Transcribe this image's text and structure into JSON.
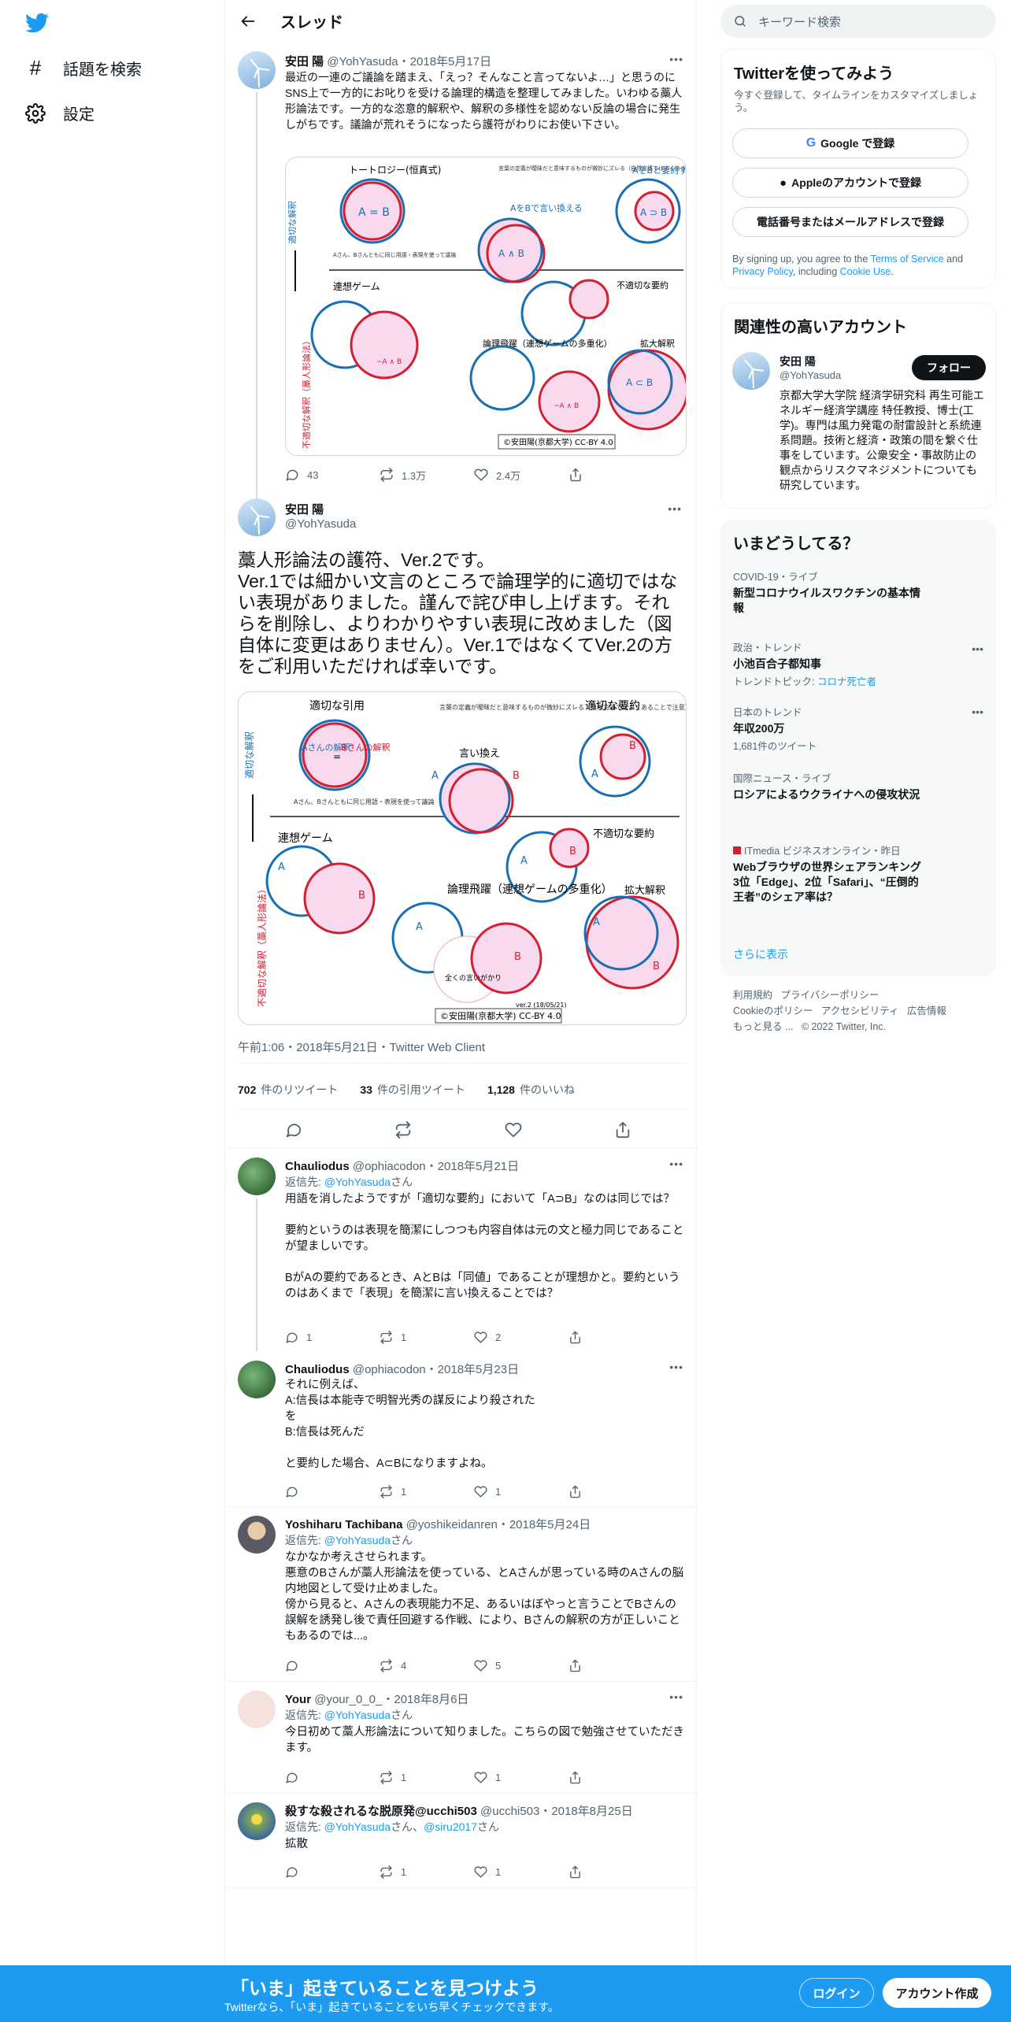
{
  "nav": {
    "explore_label": "話題を検索",
    "settings_label": "設定"
  },
  "header": {
    "title": "スレッド"
  },
  "tweet1": {
    "name": "安田 陽",
    "handle": "@YohYasuda",
    "date": "2018年5月17日",
    "text": "最近の一連のご議論を踏まえ、「えっ？そんなこと言ってないよ…」と思うのにSNS上で一方的にお叱りを受ける論理的構造を整理してみました。いわゆる藁人形論法です。一方的な恣意的解釈や、解釈の多様性を認めない反論の場合に発生しがちです。議論が荒れそうになったら護符がわりにお使い下さい。",
    "replies": "43",
    "retweets": "1.3万",
    "likes": "2.4万"
  },
  "diagram1": {
    "tautology": "トートロジー(恒真式)",
    "eq": "A = B",
    "appropriate_summary": "AをBと要約する",
    "rephrase": "AをBで言い換える",
    "left_top": "適切な解釈",
    "left_bottom": "不適切な解釈（藁人形論法）",
    "assoc": "連想ゲーム",
    "inappropriate": "不適切な要約",
    "leap": "論理飛躍（連想ゲームの多重化）",
    "expand": "拡大解釈",
    "credit": "©安田陽(京都大学) CC-BY 4.0",
    "a_and_b": "A ∧ B",
    "a_sup_b": "A ⊃ B",
    "a_sub_b": "A ⊂ B",
    "not_a_and_b": "~A ∧ B",
    "note_same": "Aさん、Bさんともに同じ用語・表現を使って議論",
    "note_def": "言葉の定義が曖昧だと意味するものが微妙にズレる（自然言語ではよくあることで注意）"
  },
  "tweet2": {
    "name": "安田 陽",
    "handle": "@YohYasuda",
    "text": "藁人形論法の護符、Ver.2です。\nVer.1では細かい文言のところで論理学的に適切ではない表現がありました。謹んで詫び申し上げます。それらを削除し、よりわかりやすい表現に改めました（図自体に変更はありません）。Ver.1ではなくてVer.2の方をご利用いただければ幸いです。",
    "time": "午前1:06・2018年5月21日・Twitter Web Client",
    "retweets_n": "702",
    "retweets_label": "件のリツイート",
    "quotes_n": "33",
    "quotes_label": "件の引用ツイート",
    "likes_n": "1,128",
    "likes_label": "件のいいね"
  },
  "diagram2": {
    "proper_quote": "適切な引用",
    "proper_summary": "適切な要約",
    "a_interp": "Aさんの解釈",
    "b_interp": "Bさんの解釈",
    "eq": "=",
    "rephrase": "言い換え",
    "left_top": "適切な解釈",
    "left_bottom": "不適切な解釈（藁人形論法）",
    "assoc": "連想ゲーム",
    "inappropriate": "不適切な要約",
    "leap": "論理飛躍（連想ゲームの多重化）",
    "expand": "拡大解釈",
    "credit": "©安田陽(京都大学) CC-BY 4.0",
    "ver": "ver.2 (18/05/21)",
    "A": "A",
    "B": "B",
    "no_relation": "全くの言いがかり",
    "note_same": "Aさん、Bさんともに同じ用語・表現を使って議論",
    "note_def": "言葉の定義が曖昧だと意味するものが微妙にズレる（自然言語ではよくあることで注意）"
  },
  "replies": [
    {
      "name": "Chauliodus",
      "handle": "@ophiacodon",
      "date": "2018年5月21日",
      "reply_to_label": "返信先:",
      "reply_to": "@YohYasuda",
      "reply_to_suffix": "さん",
      "text": "用語を消したようですが「適切な要約」において「A⊃B」なのは同じでは？\n\n要約というのは表現を簡潔にしつつも内容自体は元の文と極力同じであることが望ましいです。\n\nBがAの要約であるとき、AとBは「同値」であることが理想かと。要約というのはあくまで「表現」を簡潔に言い換えることでは？",
      "reply_count": "1",
      "retweets": "1",
      "likes": "2"
    },
    {
      "name": "Chauliodus",
      "handle": "@ophiacodon",
      "date": "2018年5月23日",
      "text": "それに例えば、\nA:信長は本能寺で明智光秀の謀反により殺された\nを\nB:信長は死んだ\n\nと要約した場合、A⊂Bになりますよね。",
      "reply_count": "",
      "retweets": "1",
      "likes": "1"
    },
    {
      "name": "Yoshiharu Tachibana",
      "handle": "@yoshikeidanren",
      "date": "2018年5月24日",
      "reply_to_label": "返信先:",
      "reply_to": "@YohYasuda",
      "reply_to_suffix": "さん",
      "text": "なかなか考えさせられます。\n悪意のBさんが藁人形論法を使っている、とAさんが思っている時のAさんの脳内地図として受け止めました。\n傍から見ると、Aさんの表現能力不足、あるいはぼやっと言うことでBさんの誤解を誘発し後で責任回避する作戦、により、Bさんの解釈の方が正しいこともあるのでは...。",
      "reply_count": "",
      "retweets": "4",
      "likes": "5"
    },
    {
      "name": "Your",
      "handle": "@your_0_0_",
      "date": "2018年8月6日",
      "reply_to_label": "返信先:",
      "reply_to": "@YohYasuda",
      "reply_to_suffix": "さん",
      "text": "今日初めて藁人形論法について知りました。こちらの図で勉強させていただきます。",
      "reply_count": "",
      "retweets": "1",
      "likes": "1"
    },
    {
      "name": "殺すな殺されるな脱原発@ucchi503",
      "handle": "@ucchi503",
      "date": "2018年8月25日",
      "reply_to_label": "返信先:",
      "reply_to": "@YohYasuda",
      "reply_to_mid": "さん、",
      "reply_to2": "@siru2017",
      "reply_to_suffix": "さん",
      "text": "拡散",
      "reply_count": "",
      "retweets": "1",
      "likes": "1"
    }
  ],
  "right": {
    "search_placeholder": "キーワード検索",
    "signup_title": "Twitterを使ってみよう",
    "signup_sub": "今すぐ登録して、タイムラインをカスタマイズしましょう。",
    "google_btn": "Google で登録",
    "apple_btn": "Appleのアカウントで登録",
    "phone_btn": "電話番号またはメールアドレスで登録",
    "terms_pre": "By signing up, you agree to the ",
    "terms_tos": "Terms of Service",
    "terms_and": " and ",
    "terms_privacy": "Privacy Policy",
    "terms_incl": ", including ",
    "terms_cookie": "Cookie Use",
    "terms_end": ".",
    "related_title": "関連性の高いアカウント",
    "related_name": "安田 陽",
    "related_handle": "@YohYasuda",
    "follow_btn": "フォロー",
    "related_bio": "京都大学大学院 経済学研究科 再生可能エネルギー経済学講座 特任教授、博士(工学)。専門は風力発電の耐雷設計と系統連系問題。技術と経済・政策の間を繋ぐ仕事をしています。公衆安全・事故防止の観点からリスクマネジメントについても研究しています。",
    "trends_title": "いまどうしてる？",
    "trends": [
      {
        "cat": "COVID-19・ライブ",
        "title": "新型コロナウイルスワクチンの基本情報",
        "sub": ""
      },
      {
        "cat": "政治・トレンド",
        "title": "小池百合子都知事",
        "sub_pre": "トレンドトピック: ",
        "sub_link": "コロナ死亡者"
      },
      {
        "cat": "日本のトレンド",
        "title": "年収200万",
        "sub": "1,681件のツイート"
      },
      {
        "cat": "国際ニュース・ライブ",
        "title": "ロシアによるウクライナへの侵攻状況",
        "sub": ""
      },
      {
        "cat": "ITmedia ビジネスオンライン・昨日",
        "title": "Webブラウザの世界シェアランキング　3位「Edge」、2位「Safari」、“圧倒的王者”のシェア率は？",
        "sub": ""
      }
    ],
    "show_more": "さらに表示",
    "footer": [
      "利用規約",
      "プライバシーポリシー",
      "Cookieのポリシー",
      "アクセシビリティ",
      "広告情報",
      "もっと見る ...",
      "© 2022 Twitter, Inc."
    ]
  },
  "bottom": {
    "title": "「いま」起きていることを見つけよう",
    "sub": "Twitterなら、「いま」起きていることをいち早くチェックできます。",
    "login": "ログイン",
    "signup": "アカウント作成"
  }
}
